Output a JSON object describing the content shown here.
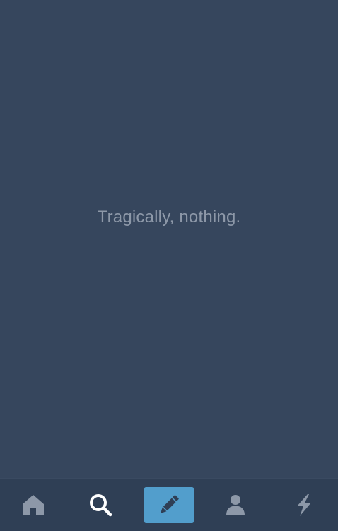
{
  "dashboard": {
    "empty_message": "Tragically, nothing."
  },
  "tabbar": {
    "items": [
      {
        "id": "home",
        "icon": "home-icon"
      },
      {
        "id": "search",
        "icon": "search-icon",
        "active": true
      },
      {
        "id": "compose",
        "icon": "pencil-icon"
      },
      {
        "id": "account",
        "icon": "person-icon"
      },
      {
        "id": "activity",
        "icon": "lightning-icon"
      }
    ]
  },
  "colors": {
    "background": "#36465d",
    "tabbar": "#2f3f55",
    "compose_accent": "#529ecc",
    "icon_inactive": "#8d98a8",
    "icon_active": "#ffffff",
    "message_text": "#8d98a8"
  }
}
